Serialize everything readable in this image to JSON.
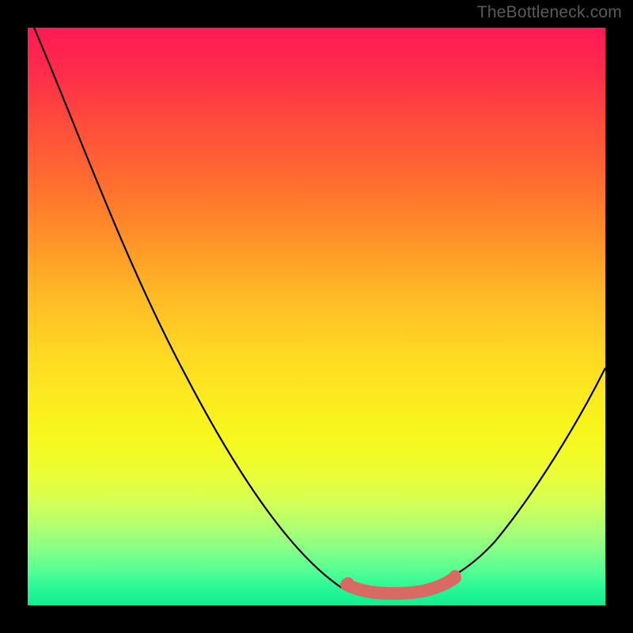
{
  "watermark": {
    "text": "TheBottleneck.com"
  },
  "chart_data": {
    "type": "line",
    "title": "",
    "xlabel": "",
    "ylabel": "",
    "x_range": [
      0,
      1
    ],
    "y_range": [
      0,
      1
    ],
    "description": "V-shaped bottleneck curve over vertical red→yellow→green gradient. High values (red) at edges; minimum (green) near x≈0.6–0.7.",
    "series": [
      {
        "name": "main-curve",
        "color": "#000000",
        "x": [
          0.0,
          0.05,
          0.1,
          0.15,
          0.2,
          0.25,
          0.3,
          0.35,
          0.4,
          0.45,
          0.5,
          0.55,
          0.58,
          0.6,
          0.64,
          0.68,
          0.72,
          0.75,
          0.8,
          0.85,
          0.9,
          0.95,
          1.0
        ],
        "y": [
          1.0,
          0.95,
          0.88,
          0.8,
          0.72,
          0.63,
          0.54,
          0.45,
          0.36,
          0.27,
          0.18,
          0.09,
          0.04,
          0.02,
          0.01,
          0.02,
          0.04,
          0.07,
          0.13,
          0.2,
          0.28,
          0.36,
          0.44
        ]
      },
      {
        "name": "highlight-band",
        "color": "#d86a63",
        "x": [
          0.55,
          0.59,
          0.63,
          0.67,
          0.71,
          0.74
        ],
        "y": [
          0.035,
          0.02,
          0.018,
          0.022,
          0.03,
          0.05
        ]
      }
    ]
  }
}
